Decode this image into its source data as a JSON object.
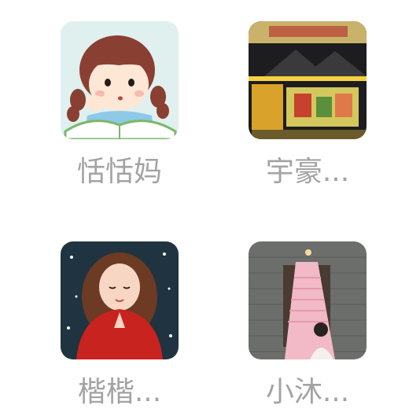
{
  "contacts": [
    {
      "name": "恬恬妈",
      "avatar": "cartoon-girl-reading-avatar"
    },
    {
      "name": "宇豪...",
      "avatar": "night-market-stall-avatar"
    },
    {
      "name": "楷楷...",
      "avatar": "girl-red-scarf-snow-avatar"
    },
    {
      "name": "小沐...",
      "avatar": "girl-pink-window-avatar"
    }
  ],
  "colors": {
    "name_text": "#a3a3a3",
    "background": "#ffffff"
  }
}
